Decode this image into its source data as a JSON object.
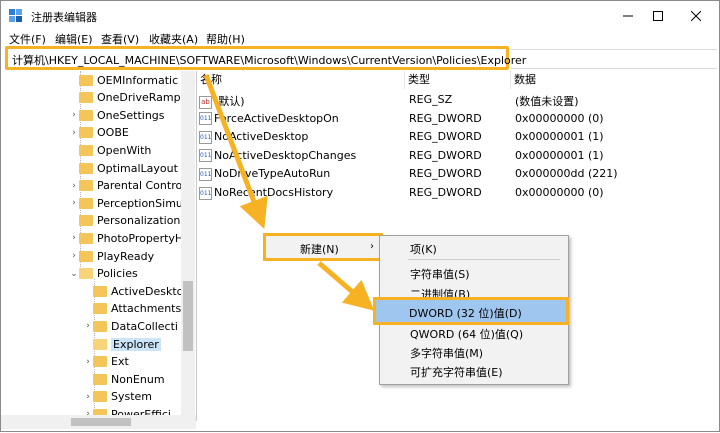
{
  "window": {
    "title": "注册表编辑器"
  },
  "menu": [
    "文件(F)",
    "编辑(E)",
    "查看(V)",
    "收藏夹(A)",
    "帮助(H)"
  ],
  "address": "计算机\\HKEY_LOCAL_MACHINE\\SOFTWARE\\Microsoft\\Windows\\CurrentVersion\\Policies\\Explorer",
  "tree": [
    {
      "label": "OEMInformatic",
      "chev": ""
    },
    {
      "label": "OneDriveRamp",
      "chev": ""
    },
    {
      "label": "OneSettings",
      "chev": "›"
    },
    {
      "label": "OOBE",
      "chev": "›"
    },
    {
      "label": "OpenWith",
      "chev": ""
    },
    {
      "label": "OptimalLayout",
      "chev": ""
    },
    {
      "label": "Parental Contro",
      "chev": "›"
    },
    {
      "label": "PerceptionSimu",
      "chev": "›"
    },
    {
      "label": "Personalization",
      "chev": ""
    },
    {
      "label": "PhotoPropertyH",
      "chev": "›"
    },
    {
      "label": "PlayReady",
      "chev": "›"
    },
    {
      "label": "Policies",
      "chev": "⌄"
    },
    {
      "label": "ActiveDesktc",
      "chev": ""
    },
    {
      "label": "Attachments",
      "chev": ""
    },
    {
      "label": "DataCollecti",
      "chev": "›"
    },
    {
      "label": "Explorer",
      "chev": ""
    },
    {
      "label": "Ext",
      "chev": "›"
    },
    {
      "label": "NonEnum",
      "chev": ""
    },
    {
      "label": "System",
      "chev": "›"
    },
    {
      "label": "PowerEffici",
      "chev": "›"
    }
  ],
  "columns": {
    "name": "名称",
    "type": "类型",
    "data": "数据"
  },
  "values": [
    {
      "name": "(默认)",
      "type": "REG_SZ",
      "data": "(数值未设置)",
      "kind": "string"
    },
    {
      "name": "ForceActiveDesktopOn",
      "type": "REG_DWORD",
      "data": "0x00000000 (0)",
      "kind": "binary"
    },
    {
      "name": "NoActiveDesktop",
      "type": "REG_DWORD",
      "data": "0x00000001 (1)",
      "kind": "binary"
    },
    {
      "name": "NoActiveDesktopChanges",
      "type": "REG_DWORD",
      "data": "0x00000001 (1)",
      "kind": "binary"
    },
    {
      "name": "NoDriveTypeAutoRun",
      "type": "REG_DWORD",
      "data": "0x000000dd (221)",
      "kind": "binary"
    },
    {
      "name": "NoRecentDocsHistory",
      "type": "REG_DWORD",
      "data": "0x00000000 (0)",
      "kind": "binary"
    }
  ],
  "context_menu": {
    "new_label": "新建(N)",
    "new_arrow": "›"
  },
  "submenu": [
    "项(K)",
    "字符串值(S)",
    "二进制值(B)",
    "DWORD (32 位)值(D)",
    "QWORD (64 位)值(Q)",
    "多字符串值(M)",
    "可扩充字符串值(E)"
  ],
  "colors": {
    "highlight": "#f6b223",
    "selected": "#9fc6ef",
    "folder": "#f4c659"
  }
}
